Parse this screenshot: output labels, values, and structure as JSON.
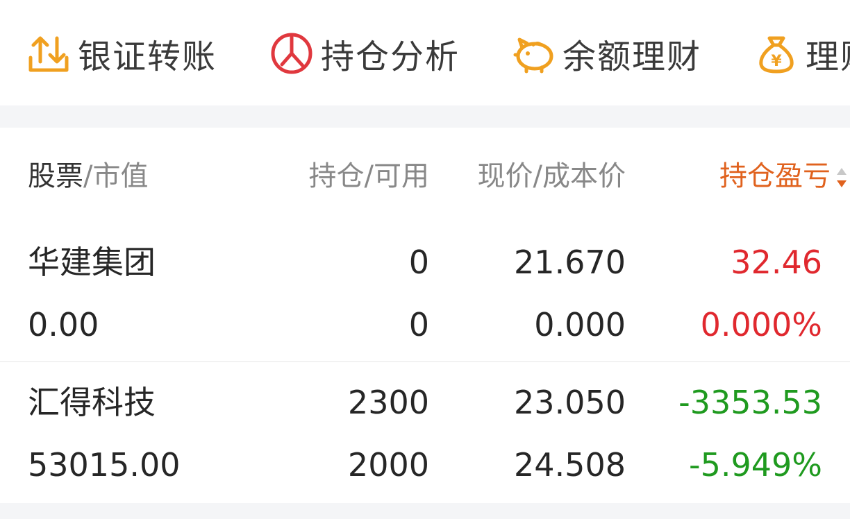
{
  "toolbar": {
    "items": [
      {
        "label": "银证转账",
        "icon": "transfer-icon"
      },
      {
        "label": "持仓分析",
        "icon": "pie-chart-icon"
      },
      {
        "label": "余额理财",
        "icon": "piggy-bank-icon"
      },
      {
        "label": "理财",
        "icon": "money-bag-icon"
      }
    ]
  },
  "table": {
    "headers": {
      "stock": "股票",
      "market_value": "/市值",
      "holding_available": "持仓/可用",
      "price_cost": "现价/成本价",
      "pnl": "持仓盈亏"
    },
    "rows": [
      {
        "name": "华建集团",
        "market_value": "0.00",
        "holding": "0",
        "available": "0",
        "price": "21.670",
        "cost": "0.000",
        "pnl": "32.46",
        "pnl_pct": "0.000%",
        "trend": "up"
      },
      {
        "name": "汇得科技",
        "market_value": "53015.00",
        "holding": "2300",
        "available": "2000",
        "price": "23.050",
        "cost": "24.508",
        "pnl": "-3353.53",
        "pnl_pct": "-5.949%",
        "trend": "down"
      }
    ]
  },
  "colors": {
    "up": "#e0282e",
    "down": "#1f9a1f",
    "accent": "#e0621e",
    "icon_orange": "#f0a020",
    "icon_red": "#e0383e"
  }
}
